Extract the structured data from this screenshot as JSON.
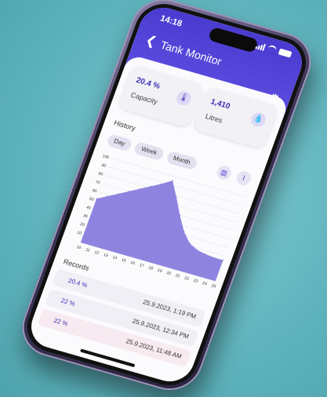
{
  "status": {
    "time": "14:18"
  },
  "app": {
    "title": "Tank Monitor",
    "back_icon": "chevron-left-icon",
    "settings_icon": "gear-icon"
  },
  "cards": [
    {
      "value": "20.4 %",
      "label": "Capacity",
      "icon": "thermometer-icon"
    },
    {
      "value": "1,410",
      "label": "Litres",
      "icon": "water-drop-icon"
    }
  ],
  "history": {
    "label": "History",
    "tabs": [
      "Day",
      "Week",
      "Month"
    ],
    "toggles": [
      "bar-chart-icon",
      "line-chart-icon"
    ]
  },
  "chart_data": {
    "type": "area",
    "x": [
      "10",
      "11",
      "12",
      "13",
      "14",
      "15",
      "16",
      "17",
      "18",
      "19",
      "20",
      "21",
      "22",
      "23",
      "24",
      "25"
    ],
    "values": [
      52,
      58,
      64,
      70,
      76,
      82,
      88,
      95,
      78,
      60,
      44,
      33,
      28,
      26,
      25,
      25
    ],
    "y_ticks": [
      10,
      20,
      30,
      40,
      50,
      60,
      70,
      80,
      90,
      100
    ],
    "ylim": [
      0,
      100
    ],
    "grid": true,
    "fill_color": "#8e84e0"
  },
  "records": {
    "label": "Records",
    "items": [
      {
        "pct": "20.4 %",
        "date": "25.9.2023, 1:19 PM"
      },
      {
        "pct": "22 %",
        "date": "25.9.2023, 12:34 PM"
      },
      {
        "pct": "22 %",
        "date": "25.9.2023, 11:48 AM"
      }
    ]
  },
  "colors": {
    "accent": "#4a3bd0",
    "background": "#5fb3bd"
  }
}
